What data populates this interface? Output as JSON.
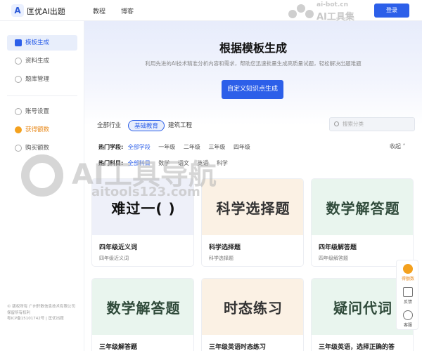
{
  "topbar": {
    "logo_glyph": "A",
    "brand": "匡优AI出题",
    "nav": [
      "教程",
      "博客"
    ],
    "login": "登录"
  },
  "watermark": {
    "site_small": "ai-bot.cn",
    "name_small": "AI工具集",
    "site_big": "AI工具导航",
    "url_big": "aitools123.com"
  },
  "sidebar": {
    "items": [
      {
        "label": "模板生成",
        "icon": "template-icon",
        "active": true
      },
      {
        "label": "资料生成",
        "icon": "document-icon",
        "active": false
      },
      {
        "label": "题库管理",
        "icon": "library-icon",
        "active": false
      }
    ],
    "items2": [
      {
        "label": "账号设置",
        "icon": "user-icon"
      },
      {
        "label": "获得额数",
        "icon": "coin-icon"
      },
      {
        "label": "购买额数",
        "icon": "cart-icon"
      }
    ],
    "footer": [
      "© 版权所有 广州轩数信息技术有限公司",
      "保留所有权利",
      "粤ICP备15101742号 | 匡优出题"
    ]
  },
  "hero": {
    "title": "根据模板生成",
    "subtitle": "利用先进的AI技术精准分析内容和需求，帮助您迅速批量生成高质量试题，轻松解决出题难题",
    "cta": "自定义知识点生成"
  },
  "industries": [
    "全部行业",
    "基础教育",
    "建筑工程"
  ],
  "search_placeholder": "搜索分类",
  "filters": {
    "stage_label": "热门学段:",
    "stages": [
      "全部学段",
      "一年级",
      "二年级",
      "三年级",
      "四年级"
    ],
    "subject_label": "热门科目:",
    "subjects": [
      "全部科目",
      "数学",
      "语文",
      "英语",
      "科学"
    ],
    "collapse": "收起"
  },
  "cards": [
    {
      "banner": "难过一(    )",
      "title": "四年级近义词",
      "sub": "四年级近义词",
      "bg": "#eef0f9",
      "fg": "#111111"
    },
    {
      "banner": "科学选择题",
      "title": "科学选择题",
      "sub": "科学选择题",
      "bg": "#fbf1e4",
      "fg": "#333333"
    },
    {
      "banner": "数学解答题",
      "title": "四年级解答题",
      "sub": "四年级解答题",
      "bg": "#e9f5ee",
      "fg": "#2f4a3a"
    },
    {
      "banner": "数学解答题",
      "title": "三年级解答题",
      "sub": "",
      "bg": "#e9f5ee",
      "fg": "#2f4a3a"
    },
    {
      "banner": "时态练习",
      "title": "三年级英语时态练习",
      "sub": "",
      "bg": "#fbf1e4",
      "fg": "#333333"
    },
    {
      "banner": "疑问代词",
      "title": "三年级英语，选择正确的答",
      "sub": "",
      "bg": "#e9f5ee",
      "fg": "#2f4a3a"
    }
  ],
  "float": [
    {
      "label": "得额数",
      "icon": "coin-icon"
    },
    {
      "label": "反馈",
      "icon": "mail-icon"
    },
    {
      "label": "客服",
      "icon": "chat-icon"
    }
  ],
  "colors": {
    "primary": "#2c5fe9",
    "orange": "#f4a11e"
  }
}
